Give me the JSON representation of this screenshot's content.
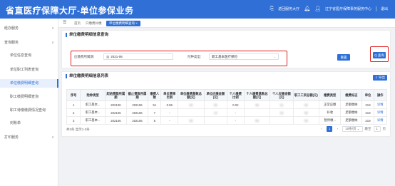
{
  "header": {
    "title": "省直医疗保障大厅-单位参保业务",
    "return_label": "返回服务大厅",
    "org_name": "辽宁省医疗保障事务服务中心",
    "logout_label": "退出"
  },
  "sidebar": {
    "items": [
      {
        "label": "经办服务",
        "arrow": "∨"
      },
      {
        "label": "查询服务",
        "arrow": "∧"
      },
      {
        "label": "单位信息查询"
      },
      {
        "label": "单位职工列表查询"
      },
      {
        "label": "单位缴费明细查询"
      },
      {
        "label": "职工缴费明细查询"
      },
      {
        "label": "职工待缴缴费情况查询"
      },
      {
        "label": "封账单"
      },
      {
        "label": "打印服务",
        "arrow": "∨"
      }
    ]
  },
  "tabs": {
    "home": "首页",
    "item1": "只缴费补缴",
    "active": "单位缴费明细查询 ×"
  },
  "query": {
    "title": "单位缴费明细信息查询",
    "period_label": "应缴费所属期:",
    "period_value": "2021-06",
    "insurance_label": "险种类型:",
    "insurance_value": "职工基本医疗保险",
    "reset_label": "重置",
    "search_label": "Q 查询"
  },
  "list": {
    "title": "单位缴费明细信息列表",
    "export_label": "⇩ 导出",
    "columns": [
      "序号",
      "险种类型",
      "起始费款所属期",
      "截止费款所属期",
      "缴费人数",
      "单位费率比例",
      "单位缴费基数总额(元)",
      "单位应缴金额(元)",
      "个人缴费比例",
      "个人缴费基数总额(元)",
      "个人应缴金额(元)",
      "职工工资总额(元)",
      "缴费类型",
      "缴费标志",
      "单位",
      "操作"
    ],
    "rows": [
      [
        "1",
        "职工基本...",
        "202106",
        "202106",
        "51",
        "0.06",
        "00",
        "00",
        "0.02",
        "00",
        "22",
        "00",
        "正常应缴",
        "足额缴纳",
        "219",
        "详情"
      ],
      [
        "2",
        "职工基本...",
        "202106",
        "202106",
        "7",
        "-",
        "",
        "13",
        "-",
        "",
        "18",
        "00",
        "补收",
        "足额缴纳",
        "219",
        "详情"
      ],
      [
        "3",
        "职工基本...",
        "202106",
        "202106",
        "5",
        "-",
        "00",
        "",
        "-",
        "00",
        "",
        "00",
        "暂停缴...",
        "足额缴纳",
        "219",
        "详情"
      ]
    ],
    "total_text": "共3条 显示1-3条",
    "page_current": "1",
    "page_size_label": "10条/页",
    "jump_label": "跳至",
    "jump_value": "1",
    "page_unit": "页"
  }
}
